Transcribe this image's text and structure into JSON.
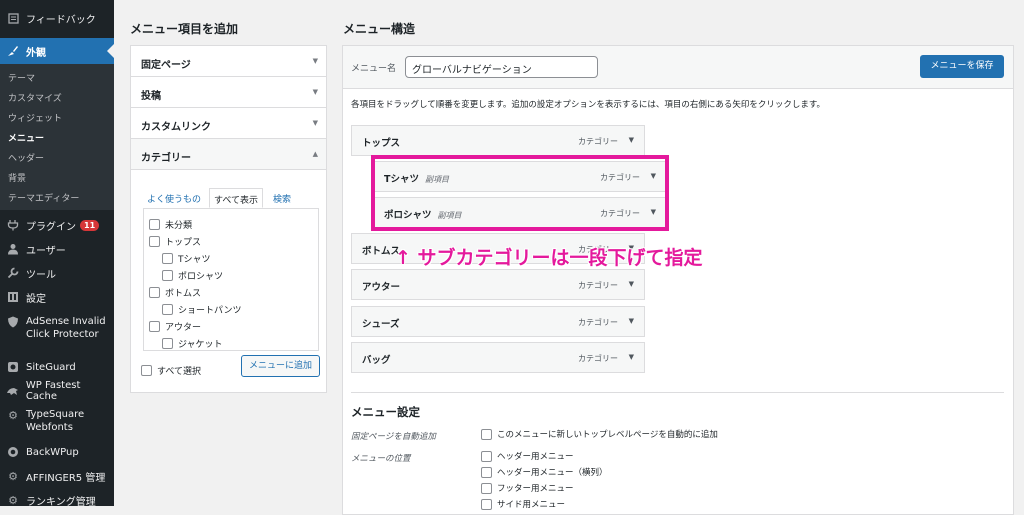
{
  "sidebar": {
    "top_items": [
      {
        "label": "フィードバック",
        "icon": "feedback-icon"
      },
      {
        "label": "外観",
        "icon": "appearance-brush-icon"
      }
    ],
    "submenu": [
      "テーマ",
      "カスタマイズ",
      "ウィジェット",
      "メニュー",
      "ヘッダー",
      "背景",
      "テーマエディター"
    ],
    "items": [
      {
        "label": "プラグイン",
        "icon": "plugin-icon",
        "badge": "11"
      },
      {
        "label": "ユーザー",
        "icon": "user-icon"
      },
      {
        "label": "ツール",
        "icon": "wrench-icon"
      },
      {
        "label": "設定",
        "icon": "settings-icon"
      },
      {
        "label": "AdSense Invalid",
        "label2": "Click Protector",
        "icon": "shield-icon"
      },
      {
        "label": "SiteGuard",
        "icon": "siteguard-icon"
      },
      {
        "label": "WP Fastest Cache",
        "icon": "cheetah-icon"
      },
      {
        "label": "TypeSquare",
        "label2": "Webfonts",
        "icon": "gear-icon"
      },
      {
        "label": "BackWPup",
        "icon": "backwpup-icon"
      },
      {
        "label": "AFFINGER5 管理",
        "icon": "gear-icon"
      },
      {
        "label": "ランキング管理",
        "icon": "gear-icon"
      }
    ]
  },
  "add_items": {
    "title": "メニュー項目を追加",
    "sections": [
      "固定ページ",
      "投稿",
      "カスタムリンク",
      "カテゴリー"
    ],
    "tabs": [
      "よく使うもの",
      "すべて表示",
      "検索"
    ],
    "categories": [
      {
        "label": "未分類",
        "level": 0
      },
      {
        "label": "トップス",
        "level": 0
      },
      {
        "label": "Tシャツ",
        "level": 1
      },
      {
        "label": "ポロシャツ",
        "level": 1
      },
      {
        "label": "ボトムス",
        "level": 0
      },
      {
        "label": "ショートパンツ",
        "level": 1
      },
      {
        "label": "アウター",
        "level": 0
      },
      {
        "label": "ジャケット",
        "level": 1
      }
    ],
    "select_all": "すべて選択",
    "add_button": "メニューに追加"
  },
  "structure": {
    "title": "メニュー構造",
    "name_label": "メニュー名",
    "name_value": "グローバルナビゲーション",
    "save_button": "メニューを保存",
    "instructions": "各項目をドラッグして順番を変更します。追加の設定オプションを表示するには、項目の右側にある矢印をクリックします。",
    "items": [
      {
        "label": "トップス",
        "type": "カテゴリー",
        "sub": ""
      },
      {
        "label": "Tシャツ",
        "type": "カテゴリー",
        "sub": "副項目"
      },
      {
        "label": "ポロシャツ",
        "type": "カテゴリー",
        "sub": "副項目"
      },
      {
        "label": "ボトムス",
        "type": "カテゴリー",
        "sub": ""
      },
      {
        "label": "アウター",
        "type": "カテゴリー",
        "sub": ""
      },
      {
        "label": "シューズ",
        "type": "カテゴリー",
        "sub": ""
      },
      {
        "label": "バッグ",
        "type": "カテゴリー",
        "sub": ""
      }
    ]
  },
  "menu_settings": {
    "title": "メニュー設定",
    "auto_add_label": "固定ページを自動追加",
    "auto_add_option": "このメニューに新しいトップレベルページを自動的に追加",
    "location_label": "メニューの位置",
    "locations": [
      "ヘッダー用メニュー",
      "ヘッダー用メニュー（横列）",
      "フッター用メニュー",
      "サイド用メニュー"
    ]
  },
  "annotation": {
    "text": "↑ サブカテゴリーは一段下げて指定",
    "color": "#e4199c"
  },
  "colors": {
    "accent": "#2271b1",
    "sidebar": "#1d2327",
    "badge": "#d63638"
  }
}
